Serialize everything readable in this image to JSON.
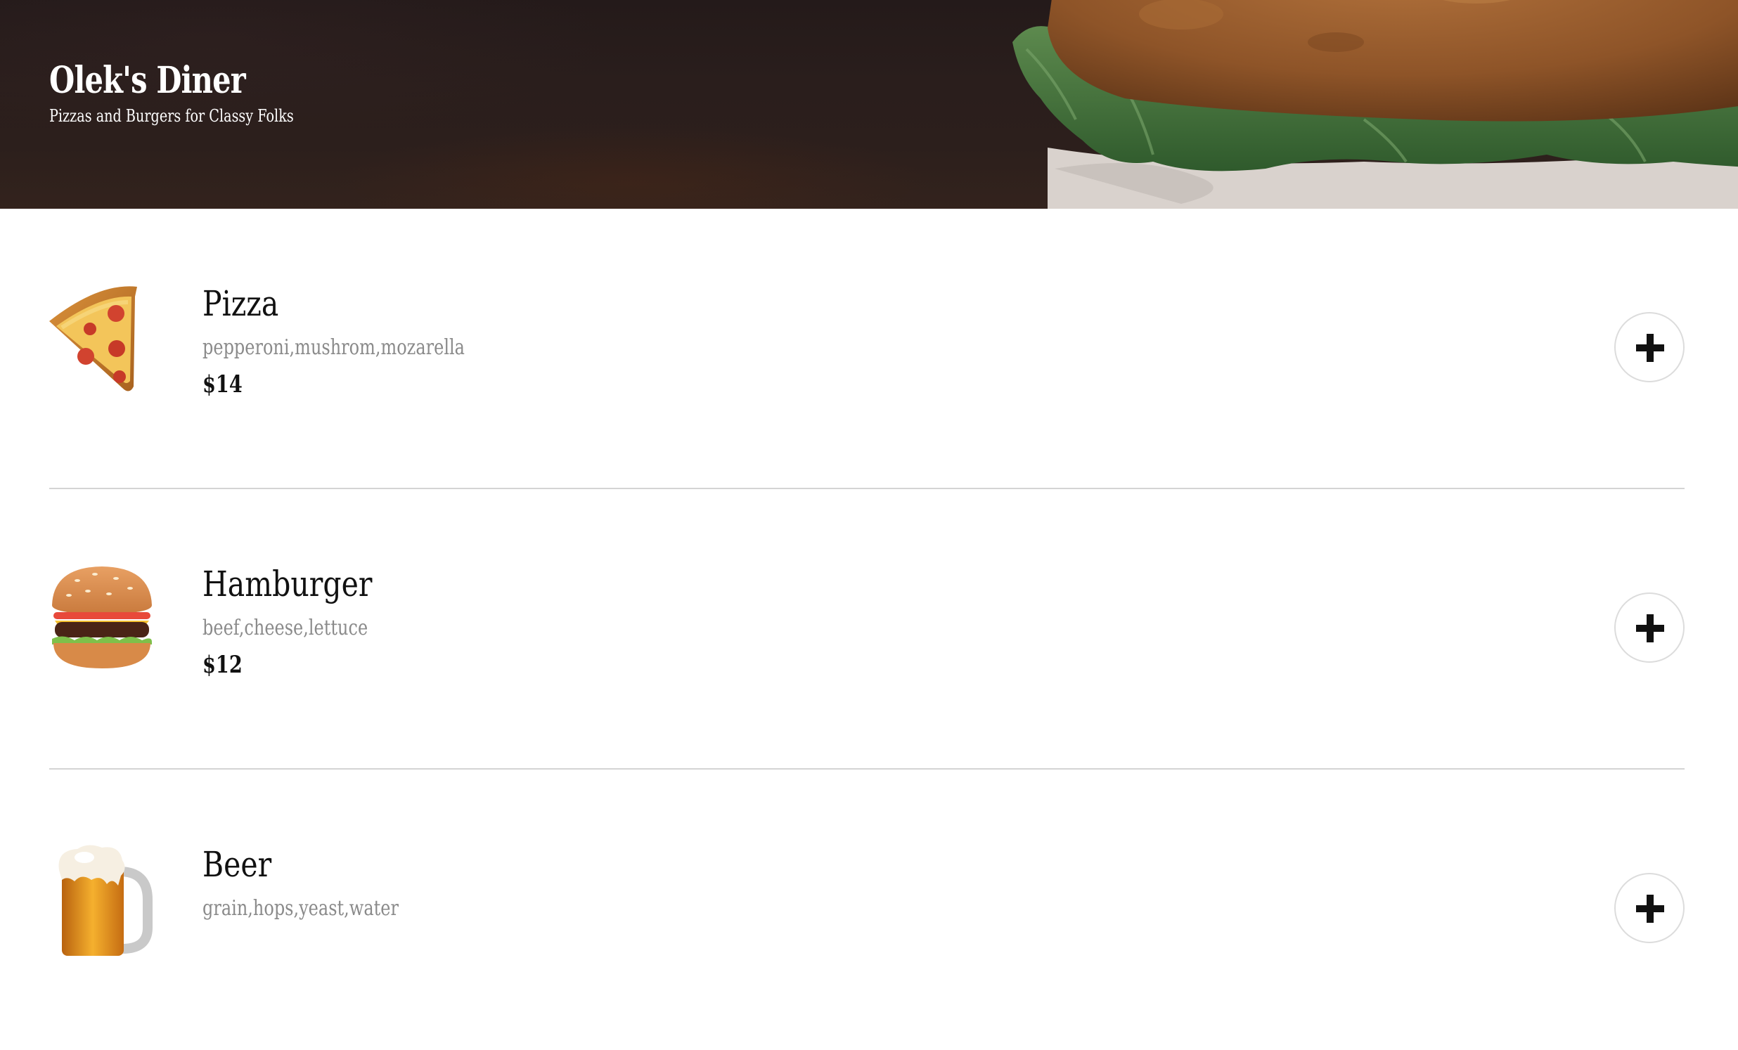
{
  "header": {
    "title": "Olek's Diner",
    "subtitle": "Pizzas and Burgers for Classy Folks"
  },
  "menu": {
    "items": [
      {
        "name": "Pizza",
        "ingredients": "pepperoni,mushrom,mozarella",
        "price": "$14",
        "icon": "pizza-icon"
      },
      {
        "name": "Hamburger",
        "ingredients": "beef,cheese,lettuce",
        "price": "$12",
        "icon": "hamburger-icon"
      },
      {
        "name": "Beer",
        "ingredients": "grain,hops,yeast,water",
        "price": "",
        "icon": "beer-icon"
      }
    ],
    "add_icon": "plus-icon"
  },
  "colors": {
    "header_bg": "#2a1e1c",
    "text": "#111111",
    "muted": "#8a8a8a",
    "divider": "#d4d4d4"
  }
}
